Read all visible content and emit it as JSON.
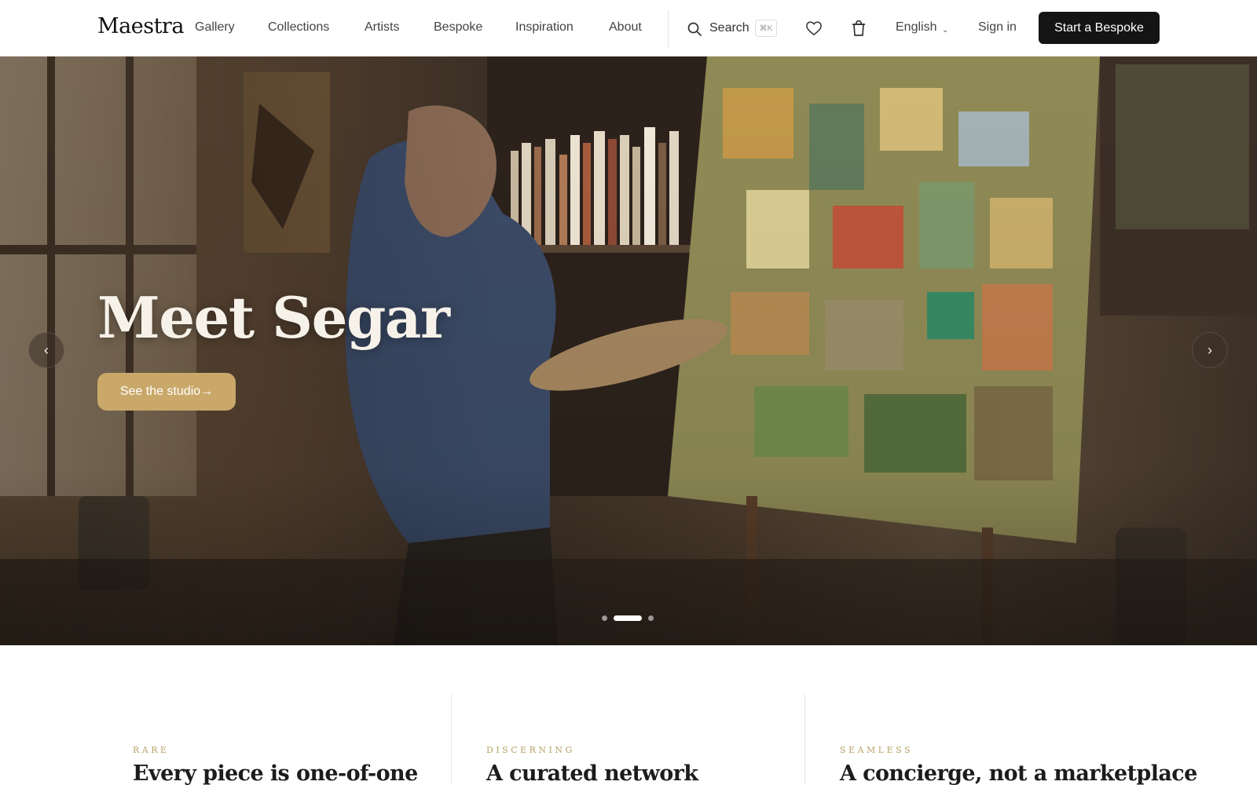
{
  "brand": {
    "name": "Maestra"
  },
  "nav": {
    "items": [
      {
        "label": "Gallery"
      },
      {
        "label": "Collections"
      },
      {
        "label": "Artists"
      },
      {
        "label": "Bespoke"
      },
      {
        "label": "Inspiration"
      },
      {
        "label": "About"
      }
    ],
    "search_label": "Search",
    "search_shortcut": "⌘K",
    "language": "English",
    "signin_label": "Sign in",
    "cta_label": "Start a Bespoke"
  },
  "hero": {
    "title": "Meet Segar",
    "button_label": "See the studio→",
    "prev_label": "‹",
    "next_label": "›",
    "slide_count": 3,
    "active_slide": 2,
    "button_color": "#c9a86a"
  },
  "features": [
    {
      "eyebrow": "RARE",
      "title": "Every piece is one-of-one"
    },
    {
      "eyebrow": "DISCERNING",
      "title": "A curated network"
    },
    {
      "eyebrow": "SEAMLESS",
      "title": "A concierge, not a marketplace"
    }
  ],
  "colors": {
    "cta_background": "#141414",
    "eyebrow_gold": "#b9a168"
  }
}
